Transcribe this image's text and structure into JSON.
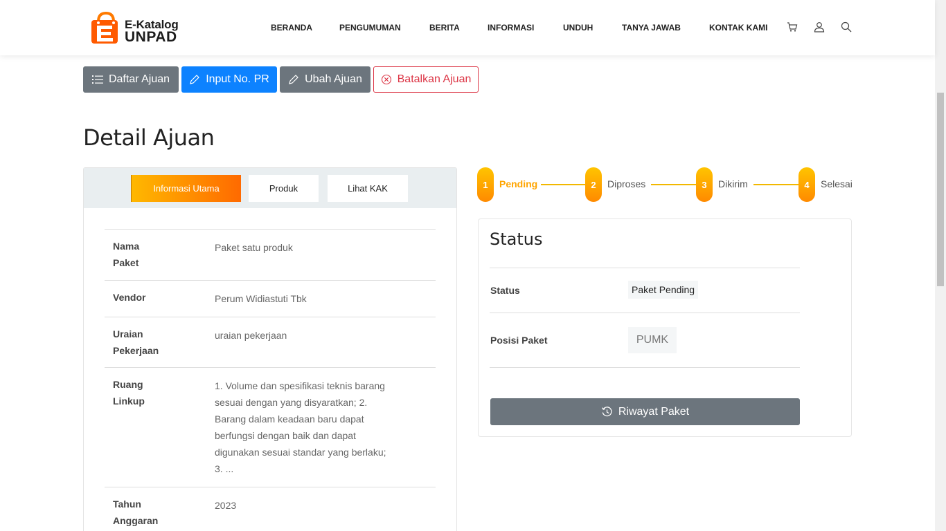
{
  "header": {
    "logo_line1": "E-Katalog",
    "logo_line2": "UNPAD",
    "nav": [
      "BERANDA",
      "PENGUMUMAN",
      "BERITA",
      "INFORMASI",
      "UNDUH",
      "TANYA JAWAB",
      "KONTAK KAMI"
    ],
    "icons": [
      "cart-icon",
      "user-icon",
      "search-icon"
    ]
  },
  "actions": {
    "daftar": "Daftar Ajuan",
    "input_pr": "Input No. PR",
    "ubah": "Ubah Ajuan",
    "batalkan": "Batalkan Ajuan"
  },
  "page_title": "Detail Ajuan",
  "tabs": [
    "Informasi Utama",
    "Produk",
    "Lihat KAK"
  ],
  "details": [
    {
      "label": "Nama Paket",
      "value": "Paket satu produk"
    },
    {
      "label": "Vendor",
      "value": "Perum Widiastuti Tbk"
    },
    {
      "label": "Uraian Pekerjaan",
      "value": "uraian pekerjaan"
    },
    {
      "label": "Ruang Linkup",
      "value": "1. Volume dan spesifikasi teknis barang sesuai dengan yang disyaratkan; 2. Barang dalam keadaan baru dapat berfungsi dengan baik dan dapat digunakan sesuai standar yang berlaku; 3. ..."
    },
    {
      "label": "Tahun Anggaran",
      "value": "2023"
    }
  ],
  "steps": [
    {
      "num": "1",
      "label": "Pending"
    },
    {
      "num": "2",
      "label": "Diproses"
    },
    {
      "num": "3",
      "label": "Dikirim"
    },
    {
      "num": "4",
      "label": "Selesai"
    }
  ],
  "status_card": {
    "title": "Status",
    "status_label": "Status",
    "status_value": "Paket Pending",
    "posisi_label": "Posisi Paket",
    "posisi_value": "PUMK",
    "riwayat": "Riwayat Paket"
  },
  "colors": {
    "accent": "#ffa500",
    "primary": "#0d82ff",
    "secondary": "#6c757d",
    "danger": "#dc3545"
  }
}
